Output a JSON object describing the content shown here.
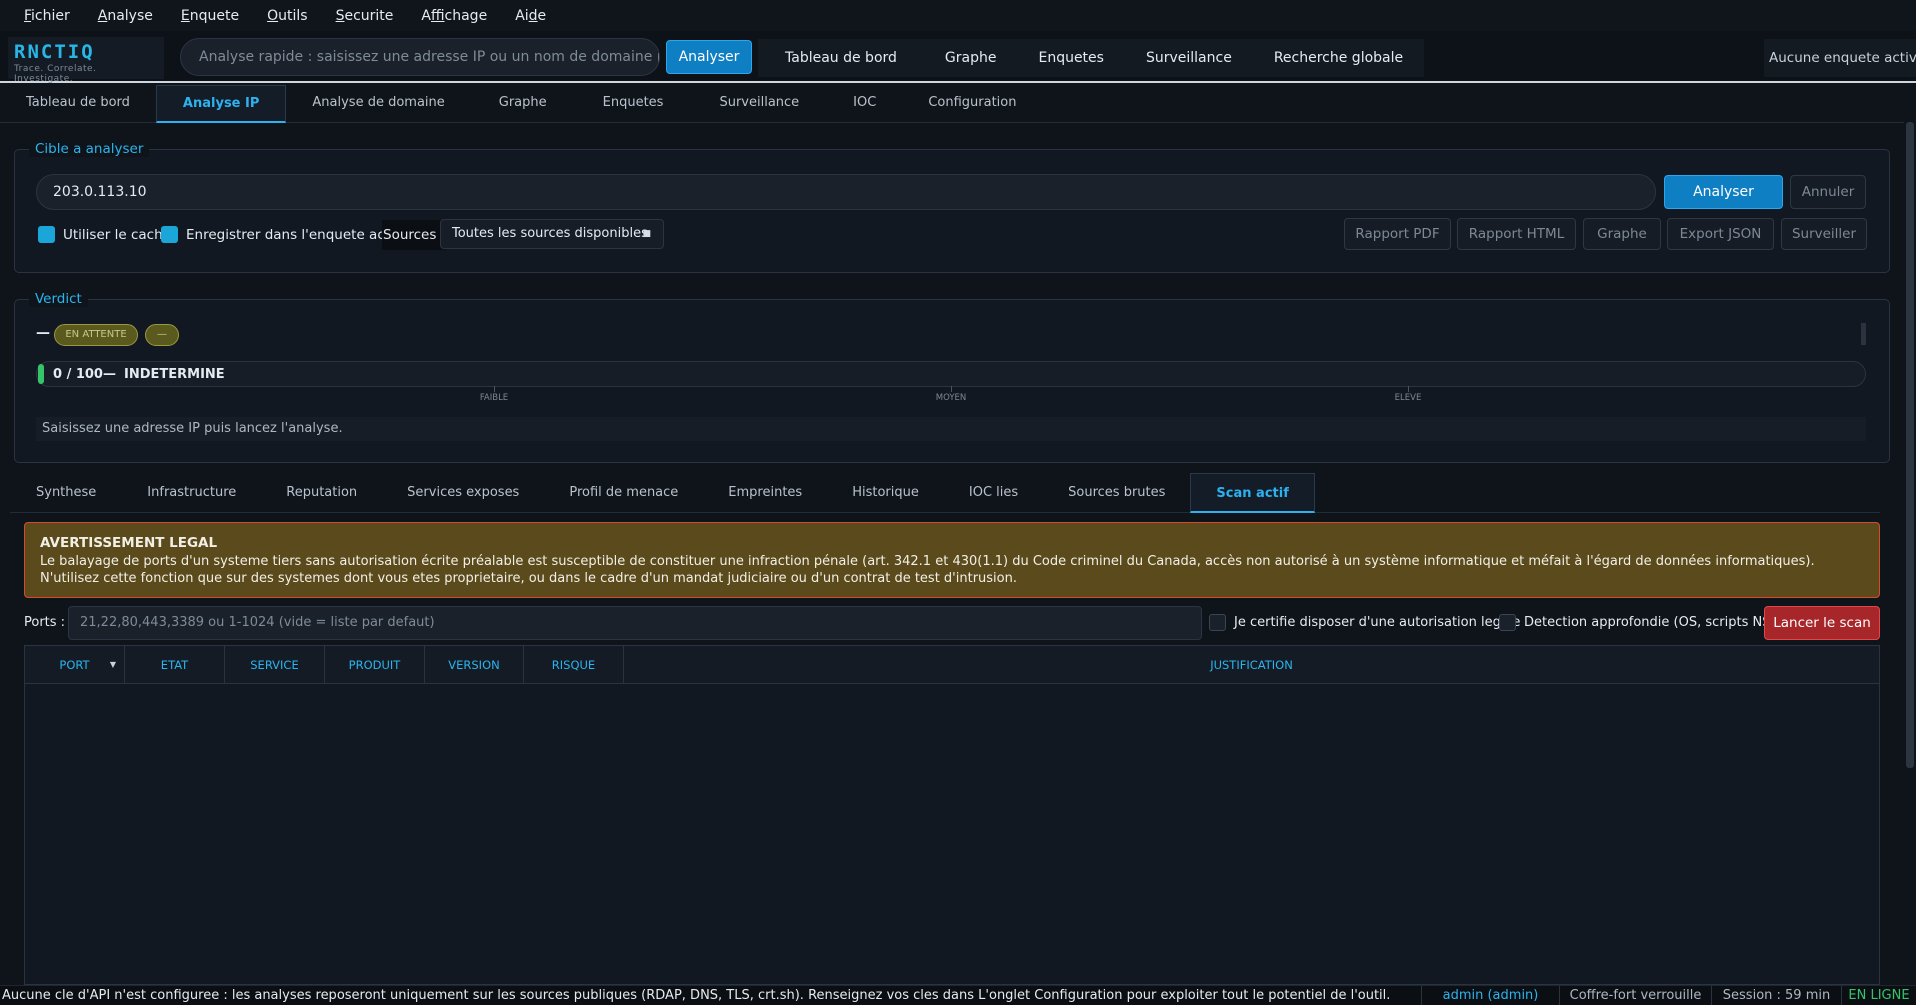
{
  "menu": [
    {
      "pre": "",
      "key": "F",
      "post": "ichier"
    },
    {
      "pre": "",
      "key": "A",
      "post": "nalyse"
    },
    {
      "pre": "",
      "key": "E",
      "post": "nquete"
    },
    {
      "pre": "",
      "key": "O",
      "post": "utils"
    },
    {
      "pre": "",
      "key": "S",
      "post": "ecurite"
    },
    {
      "pre": "A",
      "key": "f",
      "post": "fichage"
    },
    {
      "pre": "Ai",
      "key": "d",
      "post": "e"
    }
  ],
  "brand": {
    "name": "RNCTIQ",
    "tagline": "Trace. Correlate. Investigate."
  },
  "quick_search": {
    "placeholder": "Analyse rapide : saisissez une adresse IP ou un nom de domaine puis E...",
    "button": "Analyser"
  },
  "top_nav": [
    "Tableau de bord",
    "Graphe",
    "Enquetes",
    "Surveillance",
    "Recherche globale"
  ],
  "active_investigation": "Aucune enquete active",
  "main_tabs": [
    "Tableau de bord",
    "Analyse IP",
    "Analyse de domaine",
    "Graphe",
    "Enquetes",
    "Surveillance",
    "IOC",
    "Configuration"
  ],
  "main_tab_active": 1,
  "target": {
    "legend": "Cible a analyser",
    "value": "203.0.113.10",
    "analyze": "Analyser",
    "cancel": "Annuler",
    "use_cache": "Utiliser le cache",
    "save_active": "Enregistrer dans l'enquete active",
    "sources_label": "Sources :",
    "sources_value": "Toutes les sources disponibles",
    "actions": [
      "Rapport PDF",
      "Rapport HTML",
      "Graphe",
      "Export JSON",
      "Surveiller"
    ]
  },
  "verdict": {
    "legend": "Verdict",
    "dash": "—",
    "status": "EN ATTENTE",
    "badge2": "—",
    "score_text": "0 / 100",
    "separator": "—",
    "level": "INDETERMINE",
    "score": 0,
    "ticks": [
      "FAIBLE",
      "MOYEN",
      "ELEVE"
    ],
    "hint": "Saisissez une adresse IP puis lancez l'analyse."
  },
  "sub_tabs": [
    "Synthese",
    "Infrastructure",
    "Reputation",
    "Services exposes",
    "Profil de menace",
    "Empreintes",
    "Historique",
    "IOC lies",
    "Sources brutes",
    "Scan actif"
  ],
  "sub_tab_active": 9,
  "warning": {
    "title": "AVERTISSEMENT LEGAL",
    "line1": "Le balayage de ports d'un systeme tiers sans autorisation écrite préalable est susceptible de constituer une infraction pénale (art. 342.1 et 430(1.1) du Code criminel du Canada, accès non autorisé à un système informatique et méfait à l'égard de données informatiques).",
    "line2": "N'utilisez cette fonction que sur des systemes dont vous etes proprietaire, ou dans le cadre d'un mandat judiciaire ou d'un contrat de test d'intrusion."
  },
  "scan": {
    "ports_label": "Ports :",
    "ports_placeholder": "21,22,80,443,3389 ou 1-1024 (vide = liste par defaut)",
    "certify": "Je certifie disposer d'une autorisation legale",
    "deep": "Detection approfondie (OS, scripts NSE)",
    "launch": "Lancer le scan"
  },
  "table_headers": [
    "PORT",
    "ETAT",
    "SERVICE",
    "PRODUIT",
    "VERSION",
    "RISQUE",
    "JUSTIFICATION"
  ],
  "status_bar": {
    "message": "Aucune cle d'API n'est configuree : les analyses reposeront uniquement sur les sources publiques (RDAP, DNS, TLS, crt.sh). Renseignez vos cles dans L'onglet Configuration pour exploiter tout le potentiel de l'outil.",
    "user": "admin (admin)",
    "vault": "Coffre-fort verrouille",
    "session": "Session : 59 min",
    "online": "EN LIGNE"
  },
  "colors": {
    "accent": "#2db2ef",
    "primary": "#0f7fc4",
    "danger": "#a7262a",
    "online": "#35c46a"
  }
}
